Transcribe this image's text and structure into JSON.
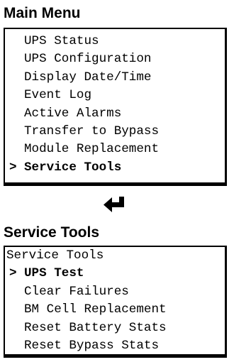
{
  "main_menu": {
    "title": "Main Menu",
    "cursor": ">",
    "items": [
      {
        "label": "UPS Status",
        "selected": false
      },
      {
        "label": "UPS Configuration",
        "selected": false
      },
      {
        "label": "Display Date/Time",
        "selected": false
      },
      {
        "label": "Event Log",
        "selected": false
      },
      {
        "label": "Active Alarms",
        "selected": false
      },
      {
        "label": "Transfer to Bypass",
        "selected": false
      },
      {
        "label": "Module Replacement",
        "selected": false
      },
      {
        "label": "Service Tools",
        "selected": true
      }
    ]
  },
  "enter_icon": "enter-return-arrow-icon",
  "service_tools": {
    "title": "Service Tools",
    "header": "Service Tools",
    "cursor": ">",
    "items": [
      {
        "label": "UPS Test",
        "selected": true
      },
      {
        "label": "Clear Failures",
        "selected": false
      },
      {
        "label": "BM Cell Replacement",
        "selected": false
      },
      {
        "label": "Reset Battery Stats",
        "selected": false
      },
      {
        "label": "Reset Bypass Stats",
        "selected": false
      }
    ]
  }
}
